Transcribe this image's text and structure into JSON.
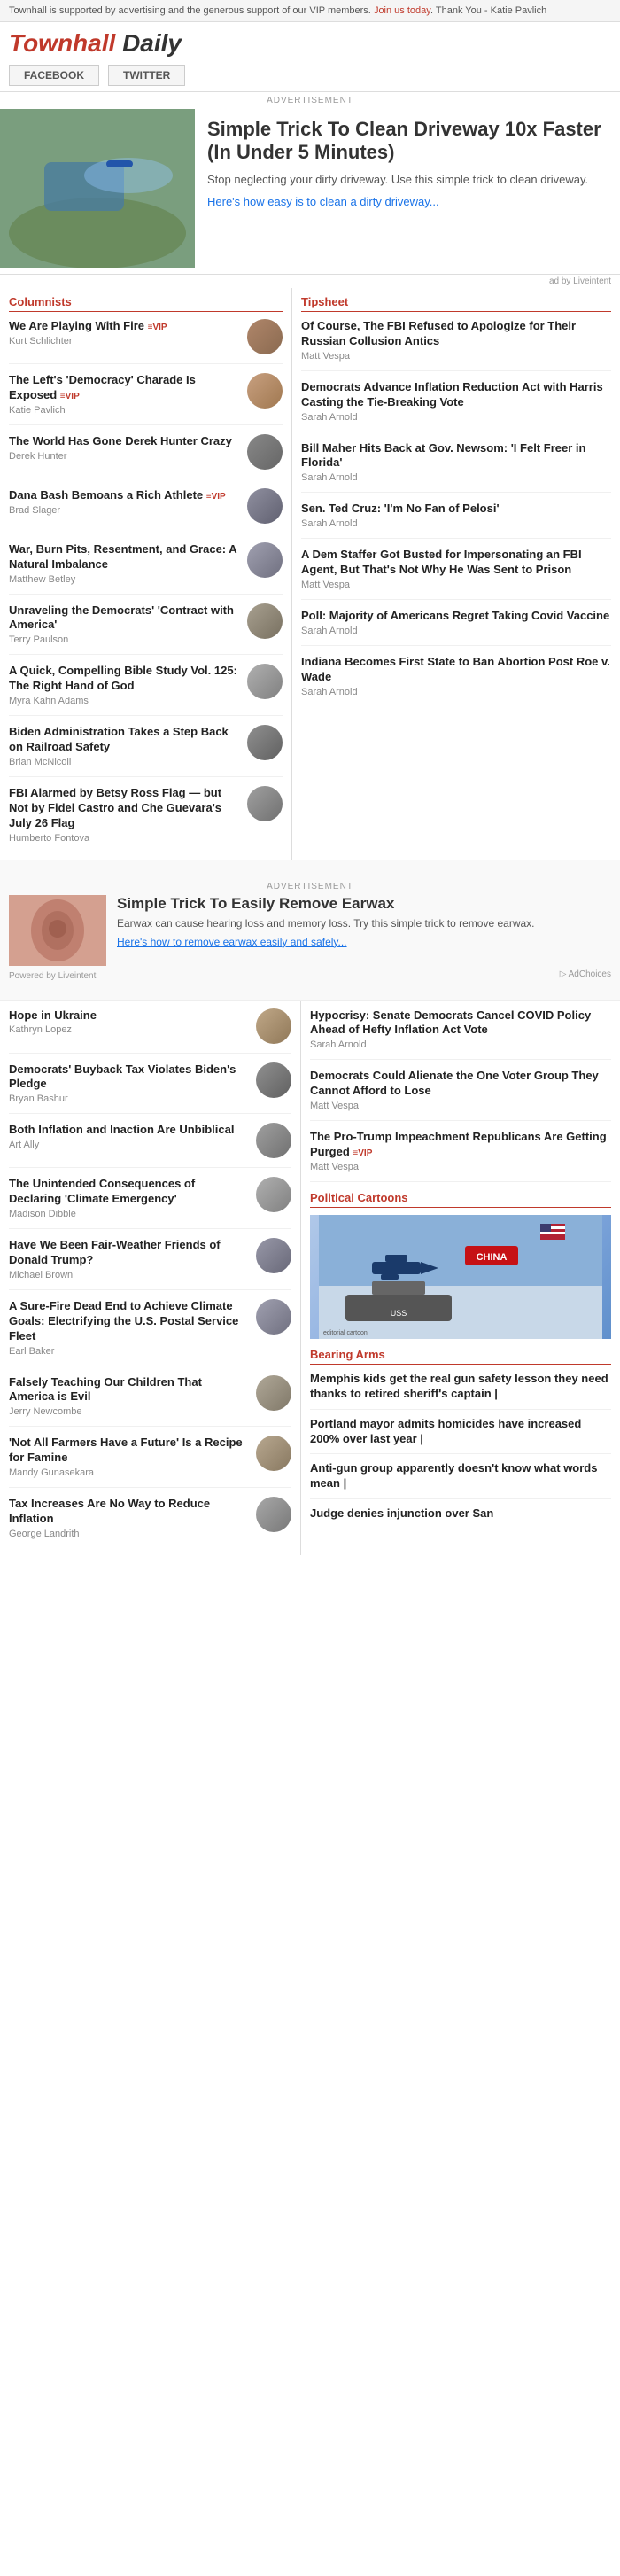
{
  "topbar": {
    "text": "Townhall is supported by advertising and the generous support of our VIP members.",
    "cta": "Join us today",
    "cta_suffix": ". Thank You - Katie Pavlich"
  },
  "header": {
    "brand": "Townhall",
    "brand_daily": "Daily"
  },
  "social": {
    "facebook": "FACEBOOK",
    "twitter": "TWITTER"
  },
  "ad_label": "ADVERTISEMENT",
  "main_ad": {
    "title": "Simple Trick To Clean Driveway 10x Faster (In Under 5 Minutes)",
    "desc": "Stop neglecting your dirty driveway. Use this simple trick to clean driveway.",
    "link": "Here's how easy is to clean a dirty driveway...",
    "attribution": "ad by Liveintent"
  },
  "columnists_title": "Columnists",
  "tipsheet_title": "Tipsheet",
  "columnists": [
    {
      "title": "We Are Playing With Fire",
      "vip": true,
      "author": "Kurt Schlichter"
    },
    {
      "title": "The Left's 'Democracy' Charade Is Exposed",
      "vip": true,
      "author": "Katie Pavlich"
    },
    {
      "title": "The World Has Gone Derek Hunter Crazy",
      "vip": false,
      "author": "Derek Hunter"
    },
    {
      "title": "Dana Bash Bemoans a Rich Athlete",
      "vip": true,
      "author": "Brad Slager"
    },
    {
      "title": "War, Burn Pits, Resentment, and Grace: A Natural Imbalance",
      "vip": false,
      "author": "Matthew Betley"
    },
    {
      "title": "Unraveling the Democrats' 'Contract with America'",
      "vip": false,
      "author": "Terry Paulson"
    },
    {
      "title": "A Quick, Compelling Bible Study Vol. 125: The Right Hand of God",
      "vip": false,
      "author": "Myra Kahn Adams"
    },
    {
      "title": "Biden Administration Takes a Step Back on Railroad Safety",
      "vip": false,
      "author": "Brian McNicoll"
    },
    {
      "title": "FBI Alarmed by Betsy Ross Flag — but Not by Fidel Castro and Che Guevara's July 26 Flag",
      "vip": false,
      "author": "Humberto Fontova"
    }
  ],
  "tipsheet": [
    {
      "title": "Of Course, The FBI Refused to Apologize for Their Russian Collusion Antics",
      "author": "Matt Vespa"
    },
    {
      "title": "Democrats Advance Inflation Reduction Act with Harris Casting the Tie-Breaking Vote",
      "author": "Sarah Arnold"
    },
    {
      "title": "Bill Maher Hits Back at Gov. Newsom: 'I Felt Freer in Florida'",
      "author": "Sarah Arnold"
    },
    {
      "title": "Sen. Ted Cruz: 'I'm No Fan of Pelosi'",
      "author": "Sarah Arnold"
    },
    {
      "title": "A Dem Staffer Got Busted for Impersonating an FBI Agent, But That's Not Why He Was Sent to Prison",
      "author": "Matt Vespa"
    },
    {
      "title": "Poll: Majority of Americans Regret Taking Covid Vaccine",
      "author": "Sarah Arnold"
    },
    {
      "title": "Indiana Becomes First State to Ban Abortion Post Roe v. Wade",
      "author": "Sarah Arnold"
    }
  ],
  "earwax_ad": {
    "title": "Simple Trick To Easily Remove Earwax",
    "desc": "Earwax can cause hearing loss and memory loss. Try this simple trick to remove earwax.",
    "link": "Here's how to remove earwax easily and safely...",
    "powered": "Powered by Liveintent"
  },
  "bottom_columnists": [
    {
      "title": "Hope in Ukraine",
      "vip": false,
      "author": "Kathryn Lopez"
    },
    {
      "title": "Democrats' Buyback Tax Violates Biden's Pledge",
      "vip": false,
      "author": "Bryan Bashur"
    },
    {
      "title": "Both Inflation and Inaction Are Unbiblical",
      "vip": false,
      "author": "Art Ally"
    },
    {
      "title": "The Unintended Consequences of Declaring 'Climate Emergency'",
      "vip": false,
      "author": "Madison Dibble"
    },
    {
      "title": "Have We Been Fair-Weather Friends of Donald Trump?",
      "vip": false,
      "author": "Michael Brown"
    },
    {
      "title": "A Sure-Fire Dead End to Achieve Climate Goals: Electrifying the U.S. Postal Service Fleet",
      "vip": false,
      "author": "Earl Baker"
    },
    {
      "title": "Falsely Teaching Our Children That America is Evil",
      "vip": false,
      "author": "Jerry Newcombe"
    },
    {
      "title": "'Not All Farmers Have a Future' Is a Recipe for Famine",
      "vip": false,
      "author": "Mandy Gunasekara"
    },
    {
      "title": "Tax Increases Are No Way to Reduce Inflation",
      "vip": false,
      "author": "George Landrith"
    }
  ],
  "bottom_tipsheet": [
    {
      "title": "Hypocrisy: Senate Democrats Cancel COVID Policy Ahead of Hefty Inflation Act Vote",
      "author": "Sarah Arnold"
    },
    {
      "title": "Democrats Could Alienate the One Voter Group They Cannot Afford to Lose",
      "author": "Matt Vespa"
    },
    {
      "title": "The Pro-Trump Impeachment Republicans Are Getting Purged",
      "vip": true,
      "author": "Matt Vespa"
    }
  ],
  "political_cartoons": "Political Cartoons",
  "bearing_arms": "Bearing Arms",
  "bearing_items": [
    {
      "title": "Memphis kids get the real gun safety lesson they need thanks to retired sheriff's captain |"
    },
    {
      "title": "Portland mayor admits homicides have increased 200% over last year |"
    },
    {
      "title": "Anti-gun group apparently doesn't know what words mean |"
    },
    {
      "title": "Judge denies injunction over San"
    }
  ]
}
